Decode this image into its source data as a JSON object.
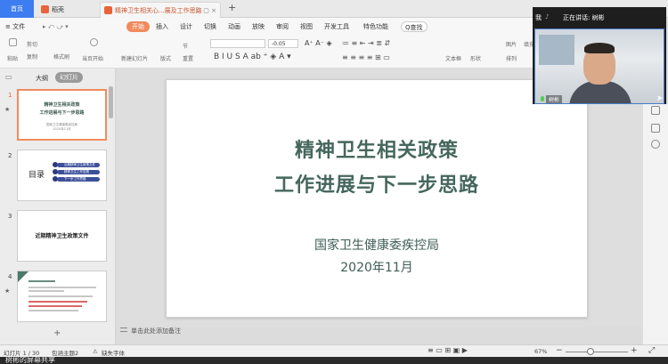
{
  "tabs": {
    "home": "首页",
    "doc1": "稻壳",
    "doc2": "精神卫生相关心...展及工作思路",
    "doc2_controls": "♡ ▢ ×"
  },
  "menu": {
    "file": "≡ 文件",
    "icons": "▸ ⤺ ⤻ ▾",
    "items": [
      "开始",
      "插入",
      "设计",
      "切换",
      "动画",
      "放映",
      "审阅",
      "视图",
      "开发工具",
      "特色功能"
    ],
    "search": "Q查找"
  },
  "ribbon": {
    "paste": "粘贴",
    "cut": "剪切",
    "copy": "复制",
    "format_painter": "格式刷",
    "play": "当页开始",
    "new_slide": "新建幻灯片",
    "layout": "版式",
    "section": "节",
    "reset": "重置",
    "font_size": "0.05",
    "text_box": "文本框",
    "shape": "形状",
    "arrange": "排列",
    "picture": "图片",
    "fill": "填充"
  },
  "left_panel": {
    "outline_tab": "大纲",
    "slides_tab": "幻灯片",
    "slides": [
      {
        "num": "1",
        "title": "精神卫生相关政策",
        "subtitle": "工作进展与下一步思路",
        "org": "国家卫生健康委疾控局",
        "date": "2020年11月"
      },
      {
        "num": "2",
        "heading": "目录",
        "items": [
          "近期精神卫生政策文件",
          "精神卫生工作进展",
          "下一步工作思路"
        ]
      },
      {
        "num": "3",
        "heading": "近期精神卫生政策文件"
      },
      {
        "num": "4"
      }
    ]
  },
  "slide": {
    "title_line1": "精神卫生相关政策",
    "title_line2": "工作进展与下一步思路",
    "org": "国家卫生健康委疾控局",
    "date": "2020年11月"
  },
  "notes_placeholder": "单击此处添加备注",
  "status": {
    "slide_count": "幻灯片 1 / 30",
    "theme": "包涵主题2",
    "missing_font": "缺失字体",
    "zoom": "67%"
  },
  "bottom": "树彬的屏幕共享",
  "video": {
    "me": "我",
    "speaking": "正在讲话: 树彬",
    "name_label": "树彬"
  },
  "colors": {
    "title_green": "#45675d",
    "accent_orange": "#f08a5d",
    "tab_blue": "#3d7df0"
  }
}
